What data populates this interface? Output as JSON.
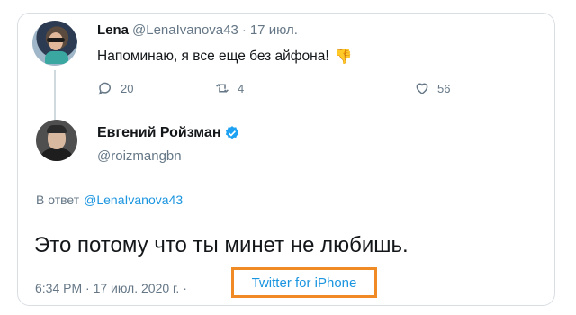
{
  "parent_tweet": {
    "name": "Lena",
    "handle": "@LenaIvanova43",
    "separator": "·",
    "date": "17 июл.",
    "text": "Напоминаю, я все еще без айфона!",
    "emoji": "👎",
    "reply_count": "20",
    "retweet_count": "4",
    "like_count": "56"
  },
  "main_tweet": {
    "name": "Евгений Ройзман",
    "handle": "@roizmangbn",
    "replying_prefix": "В ответ",
    "replying_to": "@LenaIvanova43",
    "text": "Это потому что ты минет не любишь.",
    "timestamp": "6:34 PM · 17 июл. 2020 г. ·",
    "source": "Twitter for iPhone"
  },
  "colors": {
    "link": "#1b95e0",
    "muted": "#657786",
    "highlight_border": "#f08a24",
    "verified": "#1da1f2"
  }
}
